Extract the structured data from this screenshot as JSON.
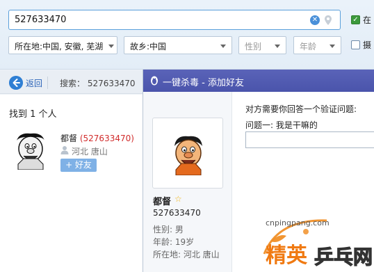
{
  "search": {
    "query": "527633470",
    "include_online_label": "在",
    "photo_label": "摄"
  },
  "filters": {
    "location": "所在地:中国, 安徽, 芜湖",
    "hometown": "故乡:中国",
    "gender_placeholder": "性别",
    "age_placeholder": "年龄"
  },
  "subbar": {
    "back_label": "返回",
    "search_crumb": "搜索：  527633470"
  },
  "results": {
    "found_text": "找到 1 个人",
    "items": [
      {
        "name": "都督",
        "qq": "(527633470)",
        "location": "河北 唐山",
        "add_label": "+ 好友"
      }
    ]
  },
  "dialog": {
    "title": "一键杀毒 - 添加好友",
    "profile": {
      "name": "都督",
      "qq": "527633470",
      "gender": "性别: 男",
      "age": "年龄: 19岁",
      "location": "所在地: 河北  唐山"
    },
    "question_prompt": "对方需要你回答一个验证问题:",
    "question": "问题一: 我是干嘛的",
    "answer_value": ""
  },
  "watermark": {
    "brand": "精英乒乓网",
    "url": "cnpingpang.com"
  },
  "colors": {
    "accent": "#4a90d9",
    "dialog_title": "#5059b0",
    "qq_red": "#d12b2b",
    "add_button": "#7fb1e6"
  }
}
